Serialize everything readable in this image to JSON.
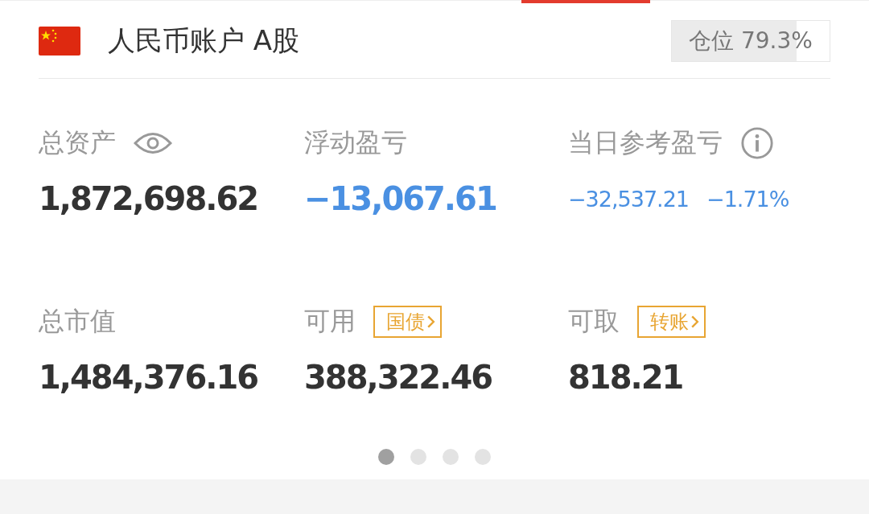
{
  "account": {
    "title": "人民币账户 A股",
    "position": {
      "label": "仓位 79.3%",
      "level": 0.793
    }
  },
  "metrics": [
    {
      "label": "总资产",
      "kind": "eye",
      "values": [
        {
          "text": "1,872,698.62",
          "kind": "plain"
        }
      ]
    },
    {
      "label": "浮动盈亏",
      "kind": "plain",
      "values": [
        {
          "text": "−13,067.61",
          "kind": "loss"
        }
      ]
    },
    {
      "label": "当日参考盈亏",
      "kind": "info",
      "values": [
        {
          "text": "−32,537.21",
          "kind": "loss"
        },
        {
          "text": "−1.71%",
          "kind": "loss"
        }
      ]
    },
    {
      "label": "总市值",
      "kind": "plain",
      "values": [
        {
          "text": "1,484,376.16",
          "kind": "plain"
        }
      ]
    },
    {
      "label": "可用",
      "kind": "action",
      "action": "国债",
      "values": [
        {
          "text": "388,322.46",
          "kind": "plain"
        }
      ]
    },
    {
      "label": "可取",
      "kind": "action",
      "action": "转账",
      "values": [
        {
          "text": "818.21",
          "kind": "plain"
        }
      ]
    }
  ],
  "pager": [
    {
      "selected": true
    },
    {
      "selected": false
    },
    {
      "selected": false
    },
    {
      "selected": false
    }
  ]
}
